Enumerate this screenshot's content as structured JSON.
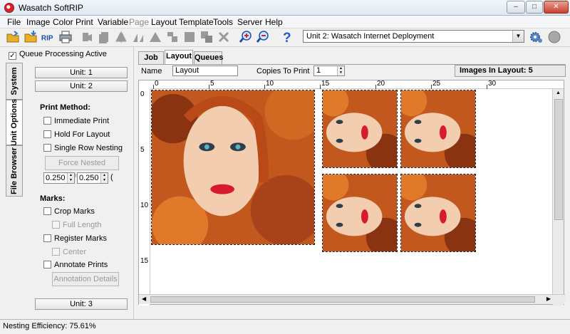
{
  "window": {
    "title": "Wasatch SoftRIP",
    "minimize": "–",
    "maximize": "□",
    "close": "✕"
  },
  "menu": [
    "File",
    "Image",
    "Color",
    "Print",
    "Variable",
    "Page",
    "Layout",
    "Template",
    "Tools",
    "Server",
    "Help"
  ],
  "menu_disabled": [
    "Page"
  ],
  "toolbar": {
    "icons": [
      "open-folder-icon",
      "save-folder-icon",
      "rip-icon",
      "printer-icon",
      "arrange-icon",
      "copy-icon",
      "flip-icon",
      "rotate-icon",
      "align-icon",
      "group-icon",
      "crop-icon",
      "duplicate-icon",
      "delete-icon",
      "zoom-in-icon",
      "zoom-out-icon",
      "help-icon"
    ],
    "rip_label": "RIP",
    "help_glyph": "?",
    "unit_select": "Unit 2: Wasatch  Internet Deployment"
  },
  "left": {
    "queue_processing": {
      "label": "Queue Processing Active",
      "checked": true
    },
    "vertical_tabs": [
      "System",
      "Unit Options",
      "File Browser"
    ],
    "units": [
      "Unit: 1",
      "Unit: 2",
      "Unit: 3"
    ],
    "print_method": {
      "label": "Print Method:",
      "options": [
        "Immediate Print",
        "Hold For Layout",
        "Single Row Nesting"
      ],
      "force_nested_button": "Force Nested Output",
      "spin1": "0.250",
      "spin2": "0.250",
      "spin_unit": "("
    },
    "marks": {
      "label": "Marks:",
      "crop_marks": "Crop Marks",
      "full_length": "Full Length",
      "register_marks": "Register Marks",
      "center": "Center",
      "annotate_prints": "Annotate Prints",
      "annotation_details_button": "Annotation Details"
    }
  },
  "right": {
    "tabs": [
      "Job",
      "Layout",
      "Queues"
    ],
    "active_tab": "Layout",
    "name_label": "Name",
    "name_value": "Layout",
    "copies_label": "Copies To Print",
    "copies_value": "1",
    "images_in_layout": "Images In Layout: 5",
    "ruler_h": [
      "0",
      "5",
      "10",
      "15",
      "20",
      "25",
      "30"
    ],
    "ruler_v": [
      "0",
      "5",
      "10",
      "15"
    ]
  },
  "status": {
    "nesting_efficiency": "Nesting Efficiency: 75.61%"
  }
}
